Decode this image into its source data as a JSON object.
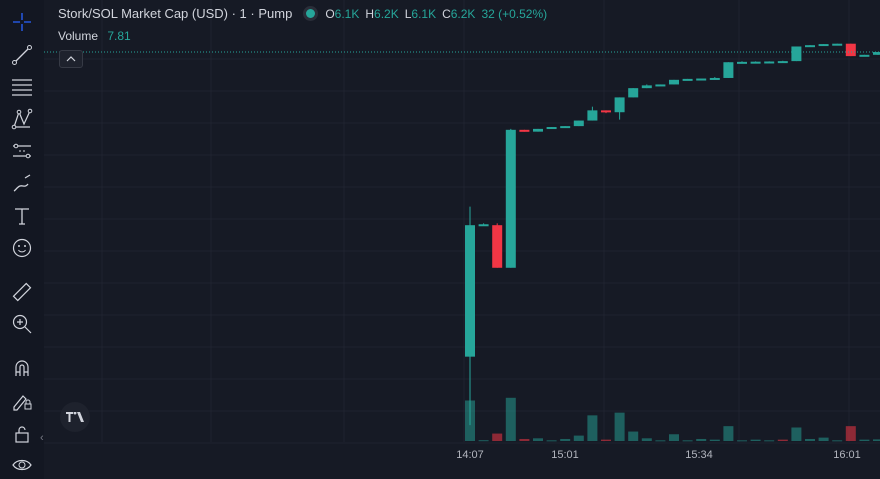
{
  "legend": {
    "title": "Stork/SOL Market Cap (USD) · 1 · Pump",
    "open_key": "O",
    "open": "6.1K",
    "high_key": "H",
    "high": "6.2K",
    "low_key": "L",
    "low": "6.1K",
    "close_key": "C",
    "close": "6.2K",
    "change": "32 (+0.52%)"
  },
  "volume": {
    "label": "Volume",
    "value": "7.81"
  },
  "colors": {
    "up": "#26a69a",
    "down": "#f23645",
    "background": "#161a25",
    "grid": "#1f2330"
  },
  "toolbar": {
    "icons": [
      "crosshair-icon",
      "trend-line-icon",
      "fib-retracement-icon",
      "pattern-icon",
      "prediction-icon",
      "brush-icon",
      "text-icon",
      "emoji-icon",
      "ruler-icon",
      "zoom-in-icon",
      "magnet-icon",
      "lock-draw-icon",
      "lock-icon",
      "eye-icon"
    ]
  },
  "chart_data": {
    "type": "candlestick",
    "x_tick_labels": [
      "14:07",
      "15:01",
      "15:34",
      "16:01"
    ],
    "candles": [
      {
        "o": 4850,
        "h": 5660,
        "l": 4480,
        "c": 5560
      },
      {
        "o": 5560,
        "h": 5570,
        "l": 5560,
        "c": 5565
      },
      {
        "o": 5560,
        "h": 5570,
        "l": 5330,
        "c": 5330
      },
      {
        "o": 5330,
        "h": 6080,
        "l": 5330,
        "c": 6075
      },
      {
        "o": 6075,
        "h": 6075,
        "l": 6065,
        "c": 6065
      },
      {
        "o": 6065,
        "h": 6080,
        "l": 6065,
        "c": 6080
      },
      {
        "o": 6080,
        "h": 6090,
        "l": 6080,
        "c": 6090
      },
      {
        "o": 6090,
        "h": 6095,
        "l": 6090,
        "c": 6095
      },
      {
        "o": 6095,
        "h": 6125,
        "l": 6095,
        "c": 6125
      },
      {
        "o": 6125,
        "h": 6200,
        "l": 6125,
        "c": 6180
      },
      {
        "o": 6180,
        "h": 6180,
        "l": 6165,
        "c": 6170
      },
      {
        "o": 6170,
        "h": 6250,
        "l": 6130,
        "c": 6250
      },
      {
        "o": 6250,
        "h": 6300,
        "l": 6250,
        "c": 6300
      },
      {
        "o": 6300,
        "h": 6320,
        "l": 6300,
        "c": 6315
      },
      {
        "o": 6315,
        "h": 6320,
        "l": 6315,
        "c": 6320
      },
      {
        "o": 6320,
        "h": 6345,
        "l": 6320,
        "c": 6345
      },
      {
        "o": 6345,
        "h": 6350,
        "l": 6345,
        "c": 6350
      },
      {
        "o": 6350,
        "h": 6350,
        "l": 6350,
        "c": 6352
      },
      {
        "o": 6352,
        "h": 6360,
        "l": 6352,
        "c": 6355
      },
      {
        "o": 6355,
        "h": 6440,
        "l": 6355,
        "c": 6440
      },
      {
        "o": 6440,
        "h": 6445,
        "l": 6440,
        "c": 6442
      },
      {
        "o": 6442,
        "h": 6445,
        "l": 6442,
        "c": 6443
      },
      {
        "o": 6443,
        "h": 6445,
        "l": 6443,
        "c": 6444
      },
      {
        "o": 6444,
        "h": 6448,
        "l": 6444,
        "c": 6446
      },
      {
        "o": 6446,
        "h": 6525,
        "l": 6446,
        "c": 6525
      },
      {
        "o": 6525,
        "h": 6532,
        "l": 6525,
        "c": 6532
      },
      {
        "o": 6532,
        "h": 6538,
        "l": 6532,
        "c": 6538
      },
      {
        "o": 6538,
        "h": 6540,
        "l": 6538,
        "c": 6540
      },
      {
        "o": 6540,
        "h": 6540,
        "l": 6473,
        "c": 6473
      },
      {
        "o": 6473,
        "h": 6480,
        "l": 6473,
        "c": 6480
      },
      {
        "o": 6480,
        "h": 6495,
        "l": 6480,
        "c": 6495
      }
    ],
    "volumes": [
      {
        "v": 30,
        "up": true
      },
      {
        "v": 0.6,
        "up": true
      },
      {
        "v": 5.5,
        "up": false
      },
      {
        "v": 32,
        "up": true
      },
      {
        "v": 1.5,
        "up": false
      },
      {
        "v": 2,
        "up": true
      },
      {
        "v": 0.5,
        "up": true
      },
      {
        "v": 1.5,
        "up": true
      },
      {
        "v": 4,
        "up": true
      },
      {
        "v": 19,
        "up": true
      },
      {
        "v": 1,
        "up": false
      },
      {
        "v": 21,
        "up": true
      },
      {
        "v": 7,
        "up": true
      },
      {
        "v": 2,
        "up": true
      },
      {
        "v": 0.5,
        "up": true
      },
      {
        "v": 5,
        "up": true
      },
      {
        "v": 0.5,
        "up": true
      },
      {
        "v": 1.5,
        "up": true
      },
      {
        "v": 1,
        "up": true
      },
      {
        "v": 11,
        "up": true
      },
      {
        "v": 0.5,
        "up": true
      },
      {
        "v": 1,
        "up": true
      },
      {
        "v": 0.5,
        "up": true
      },
      {
        "v": 1,
        "up": false
      },
      {
        "v": 10,
        "up": true
      },
      {
        "v": 1.5,
        "up": true
      },
      {
        "v": 2.5,
        "up": true
      },
      {
        "v": 0.5,
        "up": true
      },
      {
        "v": 11,
        "up": false
      },
      {
        "v": 1,
        "up": true
      },
      {
        "v": 1.2,
        "up": true
      }
    ],
    "price_range": [
      4400,
      6560
    ],
    "volume_range": [
      0,
      60
    ],
    "last_price": 6495,
    "grid": true
  }
}
